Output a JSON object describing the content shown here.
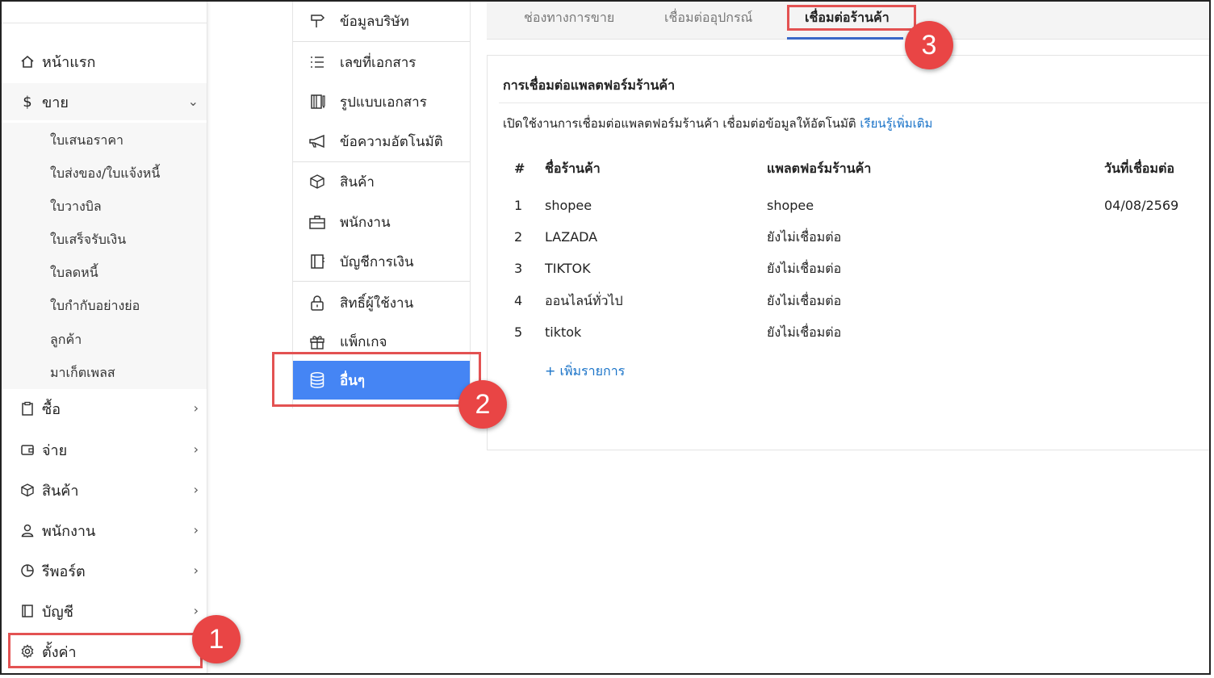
{
  "sidebar": {
    "items": [
      {
        "label": "หน้าแรก",
        "icon": "home-icon"
      },
      {
        "label": "ขาย",
        "icon": "dollar-icon",
        "expanded": true
      },
      {
        "label": "ซื้อ",
        "icon": "clipboard-icon"
      },
      {
        "label": "จ่าย",
        "icon": "wallet-icon"
      },
      {
        "label": "สินค้า",
        "icon": "box-icon"
      },
      {
        "label": "พนักงาน",
        "icon": "user-icon"
      },
      {
        "label": "รีพอร์ต",
        "icon": "pie-chart-icon"
      },
      {
        "label": "บัญชี",
        "icon": "book-icon"
      },
      {
        "label": "ตั้งค่า",
        "icon": "gear-icon"
      }
    ],
    "sale_sub_items": [
      "ใบเสนอราคา",
      "ใบส่งของ/ใบแจ้งหนี้",
      "ใบวางบิล",
      "ใบเสร็จรับเงิน",
      "ใบลดหนี้",
      "ใบกำกับอย่างย่อ",
      "ลูกค้า",
      "มาเก็ตเพลส"
    ]
  },
  "settings_menu": {
    "items": [
      {
        "label": "ข้อมูลบริษัท",
        "icon": "signpost-icon"
      },
      {
        "label": "เลขที่เอกสาร",
        "icon": "list-icon"
      },
      {
        "label": "รูปแบบเอกสาร",
        "icon": "document-style-icon"
      },
      {
        "label": "ข้อความอัตโนมัติ",
        "icon": "megaphone-icon"
      },
      {
        "label": "สินค้า",
        "icon": "box-icon"
      },
      {
        "label": "พนักงาน",
        "icon": "briefcase-icon"
      },
      {
        "label": "บัญชีการเงิน",
        "icon": "ledger-icon"
      },
      {
        "label": "สิทธิ์ผู้ใช้งาน",
        "icon": "lock-icon"
      },
      {
        "label": "แพ็กเกจ",
        "icon": "gift-icon"
      },
      {
        "label": "อื่นๆ",
        "icon": "database-icon",
        "active": true
      }
    ]
  },
  "tabs": [
    {
      "label": "ช่องทางการขาย"
    },
    {
      "label": "เชื่อมต่ออุปกรณ์"
    },
    {
      "label": "เชื่อมต่อร้านค้า",
      "active": true
    }
  ],
  "panel": {
    "title": "การเชื่อมต่อแพลตฟอร์มร้านค้า",
    "description": "เปิดใช้งานการเชื่อมต่อแพลตฟอร์มร้านค้า เชื่อมต่อข้อมูลให้อัตโนมัติ",
    "learn_more": "เรียนรู้เพิ่มเติม",
    "columns": [
      "#",
      "ชื่อร้านค้า",
      "แพลตฟอร์มร้านค้า",
      "วันที่เชื่อมต่อ"
    ],
    "rows": [
      {
        "no": "1",
        "name": "shopee",
        "platform": "shopee",
        "date": "04/08/2569"
      },
      {
        "no": "2",
        "name": "LAZADA",
        "platform": "ยังไม่เชื่อมต่อ",
        "date": ""
      },
      {
        "no": "3",
        "name": "TIKTOK",
        "platform": "ยังไม่เชื่อมต่อ",
        "date": ""
      },
      {
        "no": "4",
        "name": "ออนไลน์ทั่วไป",
        "platform": "ยังไม่เชื่อมต่อ",
        "date": ""
      },
      {
        "no": "5",
        "name": "tiktok",
        "platform": "ยังไม่เชื่อมต่อ",
        "date": ""
      }
    ],
    "add_item": "+ เพิ่มรายการ"
  },
  "annotations": {
    "step1": "1",
    "step2": "2",
    "step3": "3"
  },
  "colors": {
    "accent": "#4585f4",
    "link": "#1a73c8",
    "highlight": "#e35252",
    "badge": "#e94545"
  }
}
